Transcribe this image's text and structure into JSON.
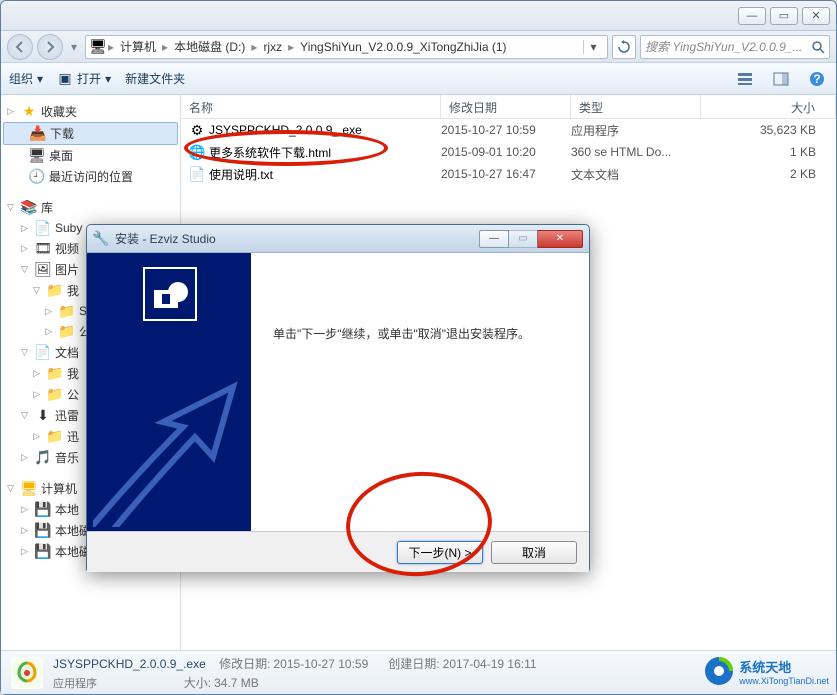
{
  "breadcrumb": {
    "parts": [
      "计算机",
      "本地磁盘 (D:)",
      "rjxz",
      "YingShiYun_V2.0.0.9_XiTongZhiJia (1)"
    ]
  },
  "search": {
    "placeholder": "搜索 YingShiYun_V2.0.0.9_..."
  },
  "toolbar": {
    "organize": "组织",
    "open": "打开",
    "newfolder": "新建文件夹"
  },
  "sidebar": {
    "fav_header": "收藏夹",
    "fav": [
      "下载",
      "桌面",
      "最近访问的位置"
    ],
    "lib_header": "库",
    "lib": [
      "Suby",
      "视频",
      "图片",
      "我",
      "S",
      "公",
      "文档",
      "我",
      "公",
      "迅雷",
      "迅",
      "音乐"
    ],
    "comp_header": "计算机",
    "comp": [
      "本地",
      "本地磁盘 (D:)",
      "本地磁盘 (E:)"
    ]
  },
  "columns": {
    "name": "名称",
    "date": "修改日期",
    "type": "类型",
    "size": "大小"
  },
  "files": [
    {
      "name": "JSYSPPCKHD_2.0.0.9_.exe",
      "date": "2015-10-27 10:59",
      "type": "应用程序",
      "size": "35,623 KB"
    },
    {
      "name": "更多系统软件下载.html",
      "date": "2015-09-01 10:20",
      "type": "360 se HTML Do...",
      "size": "1 KB"
    },
    {
      "name": "使用说明.txt",
      "date": "2015-10-27 16:47",
      "type": "文本文档",
      "size": "2 KB"
    }
  ],
  "status": {
    "name": "JSYSPPCKHD_2.0.0.9_.exe",
    "typelabel": "应用程序",
    "mod_label": "修改日期:",
    "mod_val": "2015-10-27 10:59",
    "size_label": "大小:",
    "size_val": "34.7 MB",
    "create_label": "创建日期:",
    "create_val": "2017-04-19 16:11"
  },
  "dialog": {
    "title": "安装 - Ezviz Studio",
    "body": "单击\"下一步\"继续，或单击\"取消\"退出安装程序。",
    "next": "下一步(N) >",
    "cancel": "取消"
  },
  "watermark": {
    "line1": "系统天地",
    "line2": "www.XiTongTianDi.net"
  }
}
